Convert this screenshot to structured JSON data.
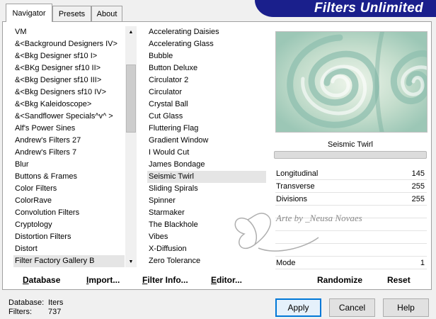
{
  "banner": {
    "title": "Filters Unlimited"
  },
  "tabs": [
    {
      "label": "Navigator"
    },
    {
      "label": "Presets"
    },
    {
      "label": "About"
    }
  ],
  "categories": {
    "items": [
      "VM",
      "&<Background Designers IV>",
      "&<Bkg Designer sf10 I>",
      "&<BKg Designer sf10 II>",
      "&<Bkg Designer sf10 III>",
      "&<Bkg Designers sf10 IV>",
      "&<Bkg Kaleidoscope>",
      "&<Sandflower Specials^v^ >",
      "Alf's Power Sines",
      "Andrew's Filters 27",
      "Andrew's Filters 7",
      "Blur",
      "Buttons & Frames",
      "Color Filters",
      "ColorRave",
      "Convolution Filters",
      "Cryptology",
      "Distortion Filters",
      "Distort",
      "Filter Factory Gallery B"
    ],
    "selected": "Filter Factory Gallery B"
  },
  "filters": {
    "items": [
      "Accelerating Daisies",
      "Accelerating Glass",
      "Bubble",
      "Button Deluxe",
      "Circulator 2",
      "Circulator",
      "Crystal Ball",
      "Cut Glass",
      "Fluttering Flag",
      "Gradient Window",
      "I Would Cut",
      "James Bondage",
      "Seismic Twirl",
      "Sliding Spirals",
      "Spinner",
      "Starmaker",
      "The Blackhole",
      "Vibes",
      "X-Diffusion",
      "Zero Tolerance"
    ],
    "selected": "Seismic Twirl"
  },
  "preview": {
    "filter_name": "Seismic Twirl",
    "colors": {
      "light": "#dcebd9",
      "mid": "#b5d4c4",
      "dark": "#8fbfaf"
    }
  },
  "params": [
    {
      "label": "Longitudinal",
      "value": "145"
    },
    {
      "label": "Transverse",
      "value": "255"
    },
    {
      "label": "Divisions",
      "value": "255"
    },
    {
      "label": "Mode",
      "value": "1"
    }
  ],
  "watermark": {
    "text": "Arte by _Neusa Novaes"
  },
  "bottom_links": {
    "database": "Database",
    "import": "Import...",
    "filter_info": "Filter Info...",
    "editor": "Editor...",
    "randomize": "Randomize",
    "reset": "Reset"
  },
  "status": {
    "database_label": "Database:",
    "database_value": "Iters",
    "filters_label": "Filters:",
    "filters_value": "737"
  },
  "buttons": {
    "apply": "Apply",
    "cancel": "Cancel",
    "help": "Help"
  }
}
